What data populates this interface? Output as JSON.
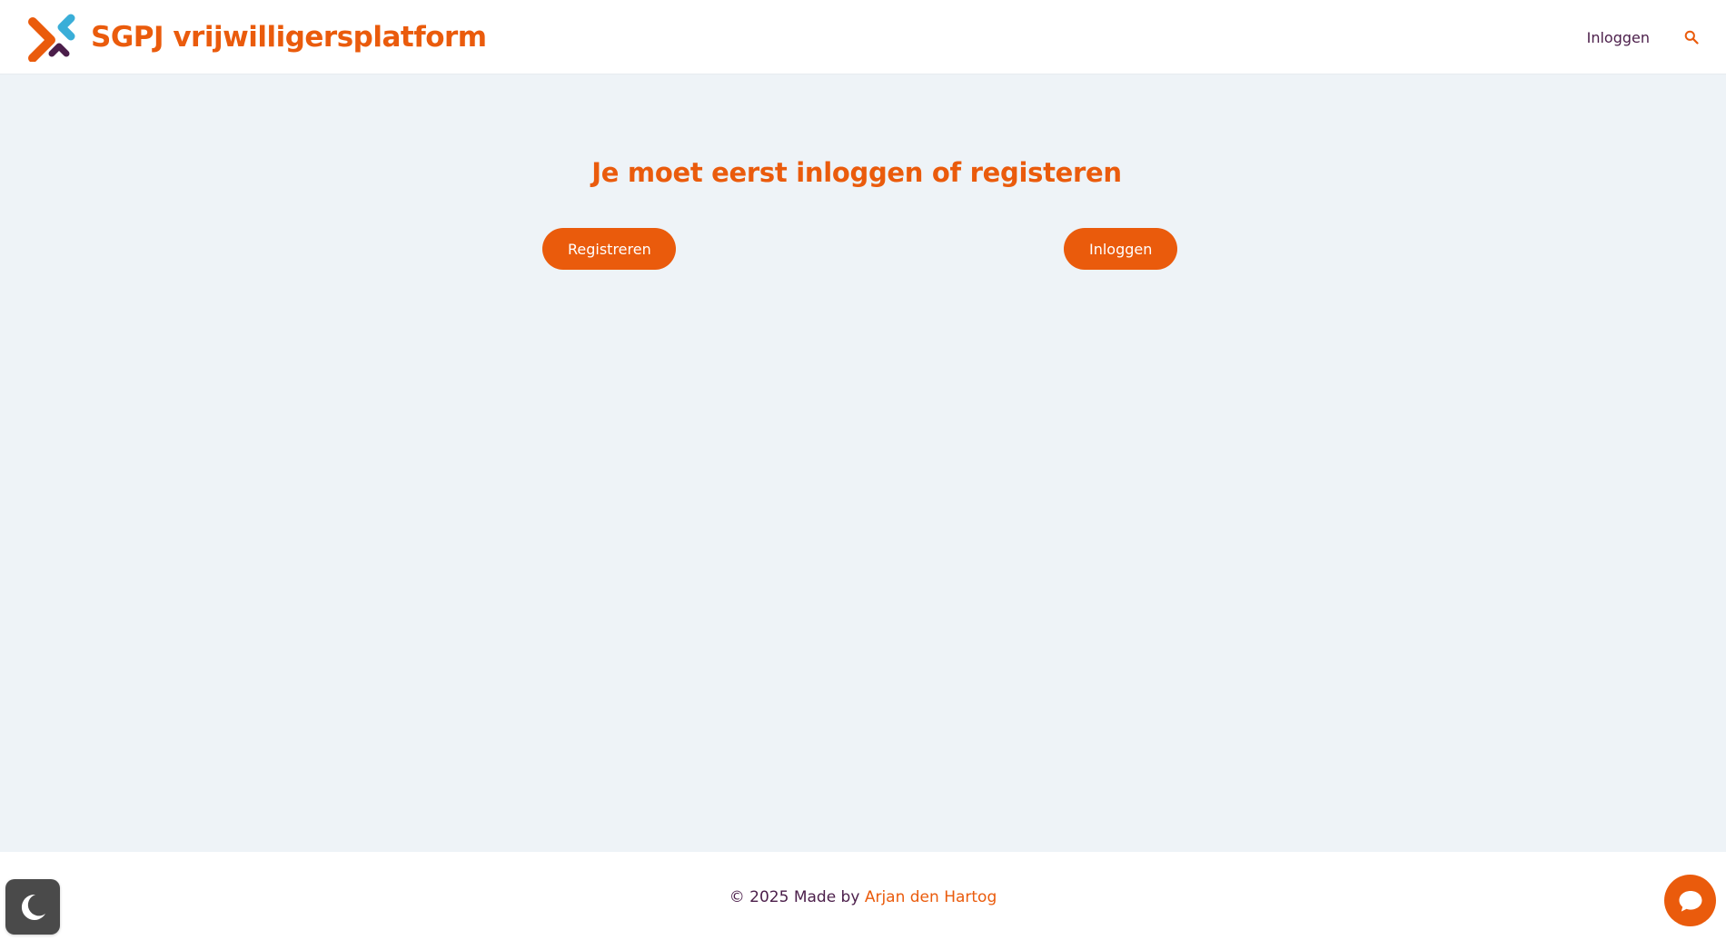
{
  "header": {
    "site_title": "SGPJ vrijwilligersplatform",
    "nav": {
      "login_label": "Inloggen"
    }
  },
  "main": {
    "notice": "Je moet eerst inloggen of registeren",
    "register_label": "Registreren",
    "login_label": "Inloggen"
  },
  "footer": {
    "copyright_prefix": "© 2025 Made by ",
    "author": "Arjan den Hartog"
  },
  "icons": {
    "logo": "sgpj-logo",
    "search": "search-icon",
    "dark_mode": "moon-icon",
    "chat": "chat-bubble-icon"
  },
  "colors": {
    "brand_orange": "#ea5b0c",
    "brand_purple": "#4b1e4a",
    "brand_blue": "#3aaed8",
    "page_background": "#eef3f7",
    "toggle_background": "#4a4a4a"
  }
}
